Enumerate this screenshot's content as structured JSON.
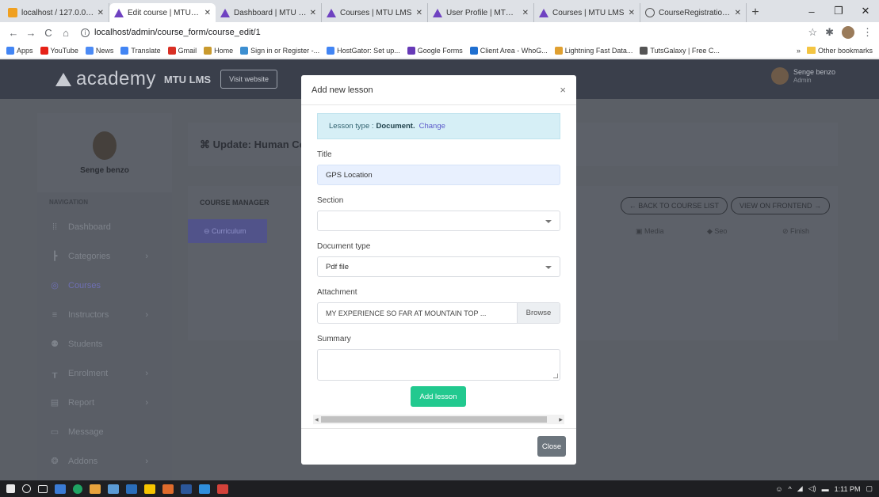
{
  "browser": {
    "tabs": [
      {
        "title": "localhost / 127.0.0.1 / m",
        "icon": "phpmyadmin-icon",
        "active": false
      },
      {
        "title": "Edit course | MTU LMS",
        "icon": "academy-icon",
        "active": true
      },
      {
        "title": "Dashboard | MTU LMS",
        "icon": "academy-icon",
        "active": false
      },
      {
        "title": "Courses | MTU LMS",
        "icon": "academy-icon",
        "active": false
      },
      {
        "title": "User Profile | MTU LMS",
        "icon": "academy-icon",
        "active": false
      },
      {
        "title": "Courses | MTU LMS",
        "icon": "academy-icon",
        "active": false
      },
      {
        "title": "CourseRegistration AKP",
        "icon": "globe-icon",
        "active": false
      }
    ],
    "url": "localhost/admin/course_form/course_edit/1",
    "bookmarks": [
      {
        "label": "Apps",
        "color": "#4285f4"
      },
      {
        "label": "YouTube",
        "color": "#e62117"
      },
      {
        "label": "News",
        "color": "#4c8bf5"
      },
      {
        "label": "Translate",
        "color": "#4285f4"
      },
      {
        "label": "Gmail",
        "color": "#d93025"
      },
      {
        "label": "Home",
        "color": "#c99a2e"
      },
      {
        "label": "Sign in or Register -...",
        "color": "#3d8fd1"
      },
      {
        "label": "HostGator: Set up...",
        "color": "#4285f4"
      },
      {
        "label": "Google Forms",
        "color": "#673ab7"
      },
      {
        "label": "Client Area - WhoG...",
        "color": "#1f6fd0"
      },
      {
        "label": "Lightning Fast Data...",
        "color": "#e0a030"
      },
      {
        "label": "TutsGalaxy | Free C...",
        "color": "#555555"
      }
    ],
    "other_bookmarks": "Other bookmarks",
    "more": "»"
  },
  "app": {
    "logo_word": "academy",
    "logo_sub": "MTU LMS",
    "visit_label": "Visit website",
    "user_name": "Senge benzo",
    "user_role": "Admin"
  },
  "sidebar": {
    "user_name": "Senge benzo",
    "heading": "NAVIGATION",
    "items": [
      {
        "label": "Dashboard",
        "icon": "grid-icon",
        "chevron": false
      },
      {
        "label": "Categories",
        "icon": "categories-icon",
        "chevron": true
      },
      {
        "label": "Courses",
        "icon": "courses-icon",
        "chevron": false,
        "active": true
      },
      {
        "label": "Instructors",
        "icon": "instructors-icon",
        "chevron": true
      },
      {
        "label": "Students",
        "icon": "students-icon",
        "chevron": false
      },
      {
        "label": "Enrolment",
        "icon": "enrolment-icon",
        "chevron": true
      },
      {
        "label": "Report",
        "icon": "report-icon",
        "chevron": true
      },
      {
        "label": "Message",
        "icon": "message-icon",
        "chevron": false
      },
      {
        "label": "Addons",
        "icon": "addons-icon",
        "chevron": true
      }
    ]
  },
  "content": {
    "title": "Update: Human Co",
    "manager_label": "COURSE MANAGER",
    "back_label": "← BACK TO COURSE LIST",
    "frontend_label": "VIEW ON FRONTEND →",
    "tabs": [
      "Curriculum",
      "Media",
      "Seo",
      "Finish"
    ]
  },
  "modal": {
    "title": "Add new lesson",
    "lesson_type_prefix": "Lesson type :",
    "lesson_type": "Document.",
    "change_label": "Change",
    "title_label": "Title",
    "title_value": "GPS Location",
    "section_label": "Section",
    "section_value": "",
    "doctype_label": "Document type",
    "doctype_value": "Pdf file",
    "attachment_label": "Attachment",
    "attachment_value": "MY EXPERIENCE SO FAR AT MOUNTAIN TOP ...",
    "browse_label": "Browse",
    "summary_label": "Summary",
    "summary_value": "",
    "add_label": "Add lesson",
    "close_label": "Close"
  },
  "taskbar": {
    "time": "1:11 PM"
  }
}
